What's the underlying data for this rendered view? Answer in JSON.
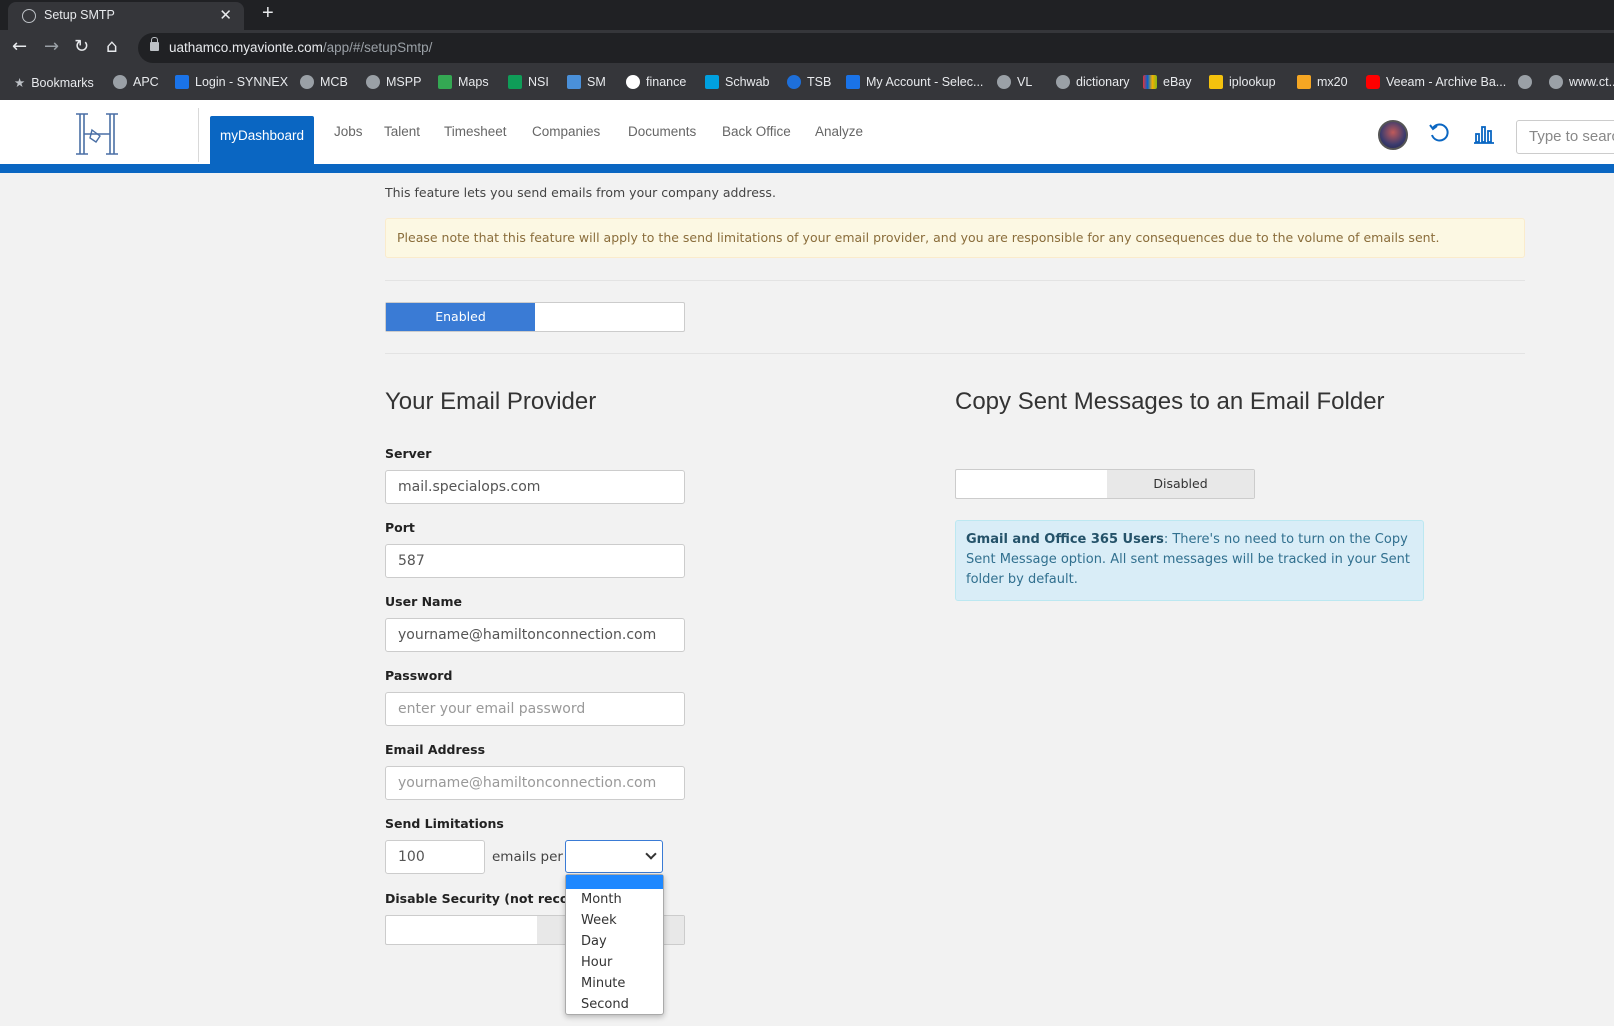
{
  "browser": {
    "tab_title": "Setup SMTP",
    "url_host": "uathamco.myavionte.com",
    "url_path": "/app/#/setupSmtp/",
    "bookmarks": [
      "Bookmarks",
      "APC",
      "Login - SYNNEX",
      "MCB",
      "MSPP",
      "Maps",
      "NSI",
      "SM",
      "finance",
      "Schwab",
      "TSB",
      "My Account - Selec...",
      "VL",
      "dictionary",
      "eBay",
      "iplookup",
      "mx20",
      "Veeam - Archive Ba...",
      "",
      "www.ct..."
    ]
  },
  "header": {
    "nav": [
      "myDashboard",
      "Jobs",
      "Talent",
      "Timesheet",
      "Companies",
      "Documents",
      "Back Office",
      "Analyze"
    ],
    "search_placeholder": "Type to search"
  },
  "colors": {
    "brand_blue": "#0a66c2",
    "toggle_blue": "#3a7bd5",
    "warning_bg": "#fcf8e3",
    "info_bg": "#d9edf7"
  },
  "main": {
    "intro": "This feature lets you send emails from your company address.",
    "warning": "Please note that this feature will apply to the send limitations of your email provider, and you are responsible for any consequences due to the volume of emails sent.",
    "enabled_toggle": {
      "on_label": "Enabled"
    },
    "provider": {
      "heading": "Your Email Provider",
      "server_label": "Server",
      "server_value": "mail.specialops.com",
      "port_label": "Port",
      "port_value": "587",
      "username_label": "User Name",
      "username_value": "yourname@hamiltonconnection.com",
      "password_label": "Password",
      "password_placeholder": "enter your email password",
      "email_label": "Email Address",
      "email_placeholder": "yourname@hamiltonconnection.com",
      "limits_label": "Send Limitations",
      "limits_value": "100",
      "emails_per": "emails per",
      "security_label": "Disable Security (not recom"
    },
    "copy": {
      "heading": "Copy Sent Messages to an Email Folder",
      "toggle_off_label": "Disabled",
      "info_bold": "Gmail and Office 365 Users",
      "info_text": ": There's no need to turn on the Copy Sent Message option. All sent messages will be tracked in your Sent folder by default."
    },
    "period_options": [
      "",
      "Month",
      "Week",
      "Day",
      "Hour",
      "Minute",
      "Second"
    ]
  }
}
